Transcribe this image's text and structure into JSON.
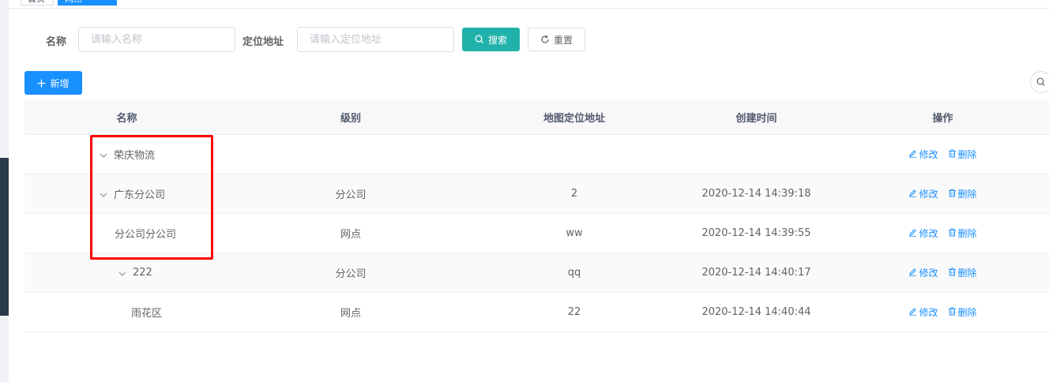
{
  "tags": {
    "tab1": "首页",
    "tab2": "网点"
  },
  "search": {
    "name_label": "名称",
    "name_placeholder": "请输入名称",
    "address_label": "定位地址",
    "address_placeholder": "请输入定位地址",
    "search_button": "搜索",
    "reset_button": "重置"
  },
  "toolbar": {
    "add_button": "新增"
  },
  "table": {
    "headers": [
      "名称",
      "级别",
      "地图定位地址",
      "创建时间",
      "操作"
    ],
    "edit_label": "修改",
    "delete_label": "删除",
    "rows": [
      {
        "name": "荣庆物流",
        "level": "",
        "address": "",
        "created": ""
      },
      {
        "name": "广东分公司",
        "level": "分公司",
        "address": "2",
        "created": "2020-12-14 14:39:18"
      },
      {
        "name": "分公司分公司",
        "level": "网点",
        "address": "ww",
        "created": "2020-12-14 14:39:55"
      },
      {
        "name": "222",
        "level": "分公司",
        "address": "qq",
        "created": "2020-12-14 14:40:17"
      },
      {
        "name": "雨花区",
        "level": "网点",
        "address": "22",
        "created": "2020-12-14 14:40:44"
      }
    ]
  },
  "colors": {
    "primary": "#1890ff",
    "search": "#20b2aa",
    "highlight": "#ff0000"
  }
}
